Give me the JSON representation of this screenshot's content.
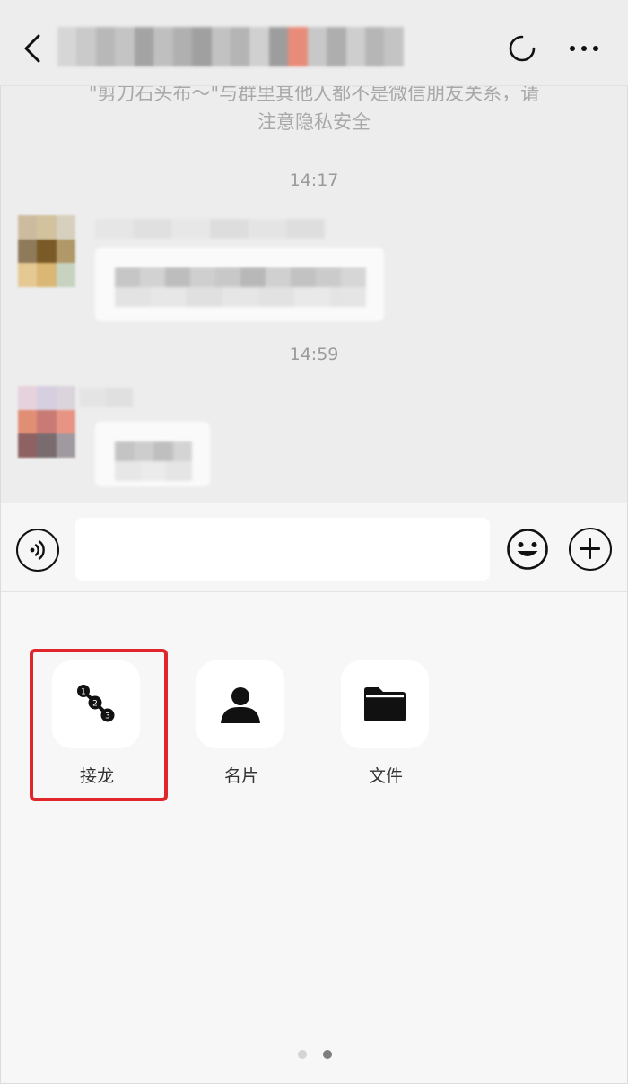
{
  "header": {
    "title_blur_colors": [
      "#d6d6d6",
      "#cacaca",
      "#b8b8b8",
      "#c4c4c4",
      "#a4a4a4",
      "#bfbfbf",
      "#b0b0b0",
      "#a0a0a0",
      "#c2c2c2",
      "#b4b4b4",
      "#d0d0d0",
      "#9d9d9d",
      "#e88c7a",
      "#c8c8c8",
      "#aeaeae",
      "#cecece",
      "#b6b6b6",
      "#c4c4c4"
    ],
    "back_icon": "chevron-left-icon",
    "loading_icon": "loading-spinner-icon",
    "more_icon": "more-dots-icon"
  },
  "chat": {
    "notice_line1": "\"剪刀石头布～\"与群里其他人都不是微信朋友关系，请",
    "notice_line2": "注意隐私安全",
    "time1": "14:17",
    "time2": "14:59"
  },
  "input_bar": {
    "voice_icon": "voice-icon",
    "emoji_icon": "emoji-icon",
    "plus_icon": "plus-circle-icon",
    "placeholder": ""
  },
  "panel": {
    "tools": [
      {
        "label": "接龙",
        "icon": "solitaire-icon"
      },
      {
        "label": "名片",
        "icon": "contact-card-icon"
      },
      {
        "label": "文件",
        "icon": "folder-icon"
      }
    ],
    "highlight_color": "#e0262b",
    "page_count": 2,
    "active_page": 2
  }
}
